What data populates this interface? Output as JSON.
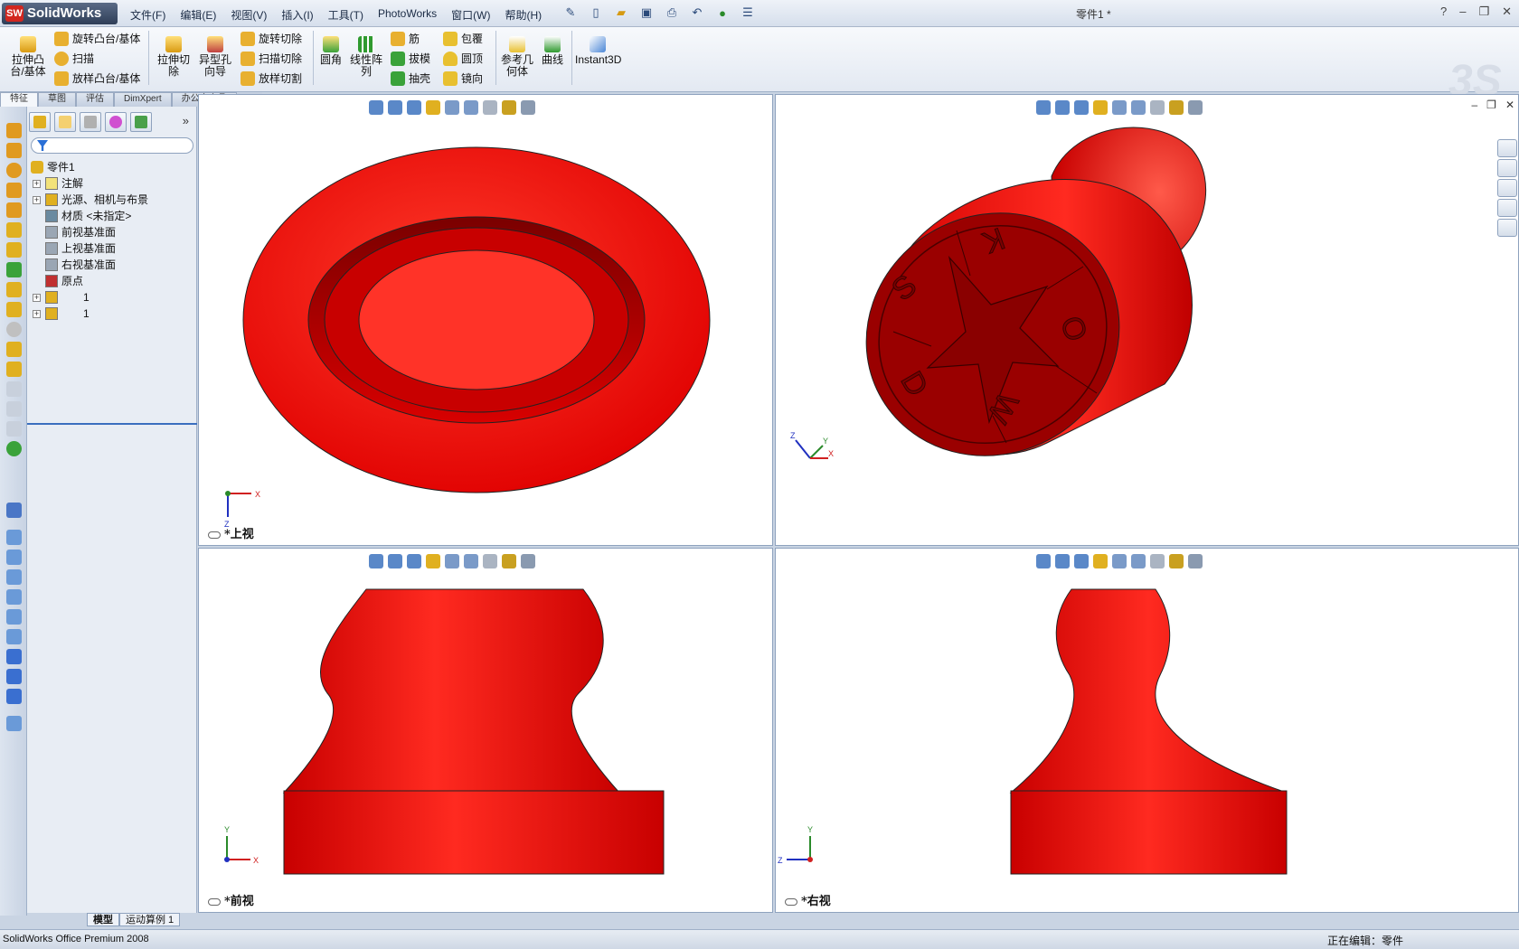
{
  "app": {
    "logo_text": "SolidWorks",
    "logo_badge": "SW",
    "document_title": "零件1 *"
  },
  "menus": [
    "文件(F)",
    "编辑(E)",
    "视图(V)",
    "插入(I)",
    "工具(T)",
    "PhotoWorks",
    "窗口(W)",
    "帮助(H)"
  ],
  "ribbon": {
    "extrude_boss": "拉伸凸\n台/基体",
    "revolve_boss": "旋转凸台/基体",
    "sweep": "扫描",
    "loft_boss": "放样凸台/基体",
    "extrude_cut": "拉伸切\n除",
    "hole_wizard": "异型孔\n向导",
    "revolve_cut": "旋转切除",
    "sweep_cut": "扫描切除",
    "loft_cut": "放样切割",
    "fillet": "圆角",
    "linear_pattern": "线性阵\n列",
    "rib": "筋",
    "draft": "拔模",
    "shell": "抽壳",
    "wrap": "包覆",
    "dome": "圆顶",
    "mirror": "镜向",
    "ref_geometry": "参考几\n何体",
    "curves": "曲线",
    "instant3d": "Instant3D"
  },
  "ribbon_tabs": [
    "特征",
    "草图",
    "评估",
    "DimXpert",
    "办公室产品"
  ],
  "feature_tree": {
    "root": "零件1",
    "items": [
      {
        "label": "注解",
        "expandable": true,
        "icon": "annotation-icon"
      },
      {
        "label": "光源、相机与布景",
        "expandable": true,
        "icon": "lights-icon"
      },
      {
        "label": "材质 <未指定>",
        "expandable": false,
        "icon": "material-icon"
      },
      {
        "label": "前视基准面",
        "expandable": false,
        "icon": "plane-icon"
      },
      {
        "label": "上视基准面",
        "expandable": false,
        "icon": "plane-icon"
      },
      {
        "label": "右视基准面",
        "expandable": false,
        "icon": "plane-icon"
      },
      {
        "label": "原点",
        "expandable": false,
        "icon": "origin-icon"
      },
      {
        "label": "1",
        "expandable": true,
        "icon": "feature-icon"
      },
      {
        "label": "1",
        "expandable": true,
        "icon": "feature-icon"
      }
    ]
  },
  "bottom_tabs": [
    "模型",
    "运动算例 1"
  ],
  "viewports": {
    "top": {
      "label": "*上视"
    },
    "iso": {
      "label": ""
    },
    "front": {
      "label": "*前视"
    },
    "right": {
      "label": "*右视"
    }
  },
  "stamp_letters": [
    "S",
    "K",
    "O",
    "W",
    "D"
  ],
  "colors": {
    "part_red": "#ee1111",
    "part_dark": "#a80000"
  },
  "status": {
    "product": "SolidWorks Office Premium 2008",
    "editing": "正在编辑：零件"
  }
}
